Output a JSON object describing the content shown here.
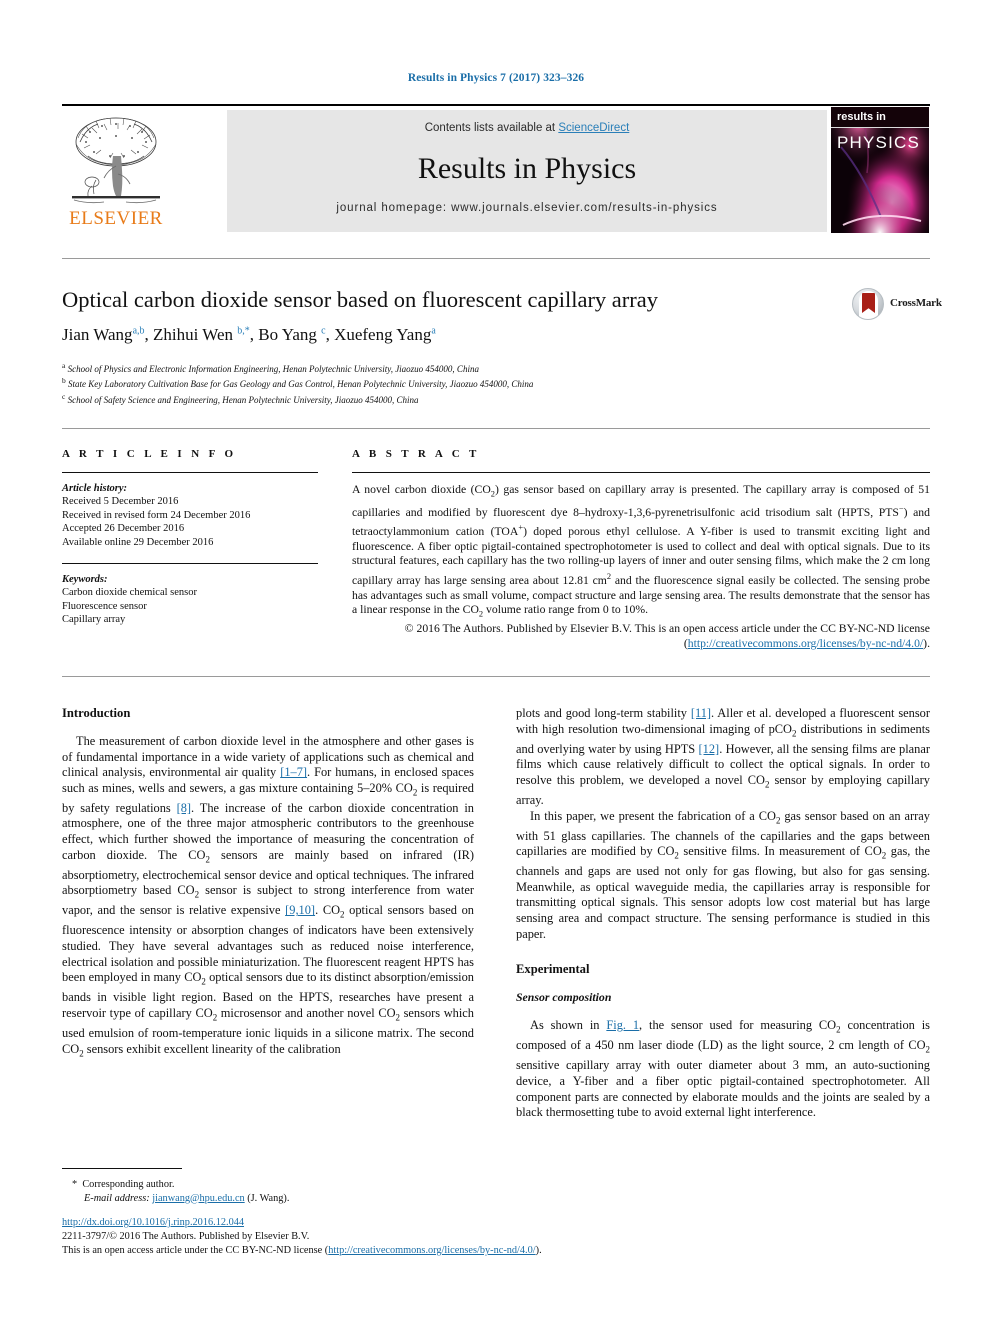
{
  "running_head": "Results in Physics 7 (2017) 323–326",
  "masthead": {
    "contents_prefix": "Contents lists available at ",
    "sciencedirect": "ScienceDirect",
    "journal_title": "Results in Physics",
    "homepage": "journal homepage: www.journals.elsevier.com/results-in-physics",
    "publisher_logo_text": "ELSEVIER",
    "cover_label_top": "results in",
    "cover_label_main": "PHYSICS",
    "accent_color": "#2a7fb8",
    "elsevier_orange": "#E87B19"
  },
  "article": {
    "title": "Optical carbon dioxide sensor based on fluorescent capillary array",
    "crossmark_label": "CrossMark",
    "authors_plain": "Jian Wang a,b, Zhihui Wen b,*, Bo Yang c, Xuefeng Yang a",
    "affiliations": [
      "School of Physics and Electronic Information Engineering, Henan Polytechnic University, Jiaozuo 454000, China",
      "State Key Laboratory Cultivation Base for Gas Geology and Gas Control, Henan Polytechnic University, Jiaozuo 454000, China",
      "School of Safety Science and Engineering, Henan Polytechnic University, Jiaozuo 454000, China"
    ]
  },
  "article_info": {
    "heading": "A R T I C L E   I N F O",
    "history_label": "Article history:",
    "history": [
      "Received 5 December 2016",
      "Received in revised form 24 December 2016",
      "Accepted 26 December 2016",
      "Available online 29 December 2016"
    ],
    "keywords_label": "Keywords:",
    "keywords": [
      "Carbon dioxide chemical sensor",
      "Fluorescence sensor",
      "Capillary array"
    ]
  },
  "abstract": {
    "heading": "A B S T R A C T",
    "body_part1": "A novel carbon dioxide (CO",
    "body_part2": ") gas sensor based on capillary array is presented. The capillary array is composed of 51 capillaries and modified by fluorescent dye 8–hydroxy-1,3,6-pyrenetrisulfonic acid trisodium salt (HPTS, PTS",
    "body_part3": ") and tetraoctylammonium cation (TOA",
    "body_part4": ") doped porous ethyl cellulose. A Y-fiber is used to transmit exciting light and fluorescence. A fiber optic pigtail-contained spectrophotometer is used to collect and deal with optical signals. Due to its structural features, each capillary has the two rolling-up layers of inner and outer sensing films, which make the 2 cm long capillary array has large sensing area about 12.81 cm",
    "body_part5": " and the fluorescence signal easily be collected. The sensing probe has advantages such as small volume, compact structure and large sensing area. The results demonstrate that the sensor has a linear response in the CO",
    "body_part6": " volume ratio range from 0 to 10%.",
    "copyright_text": "© 2016 The Authors. Published by Elsevier B.V. This is an open access article under the CC BY-NC-ND license (",
    "license_url": "http://creativecommons.org/licenses/by-nc-nd/4.0/",
    "copyright_tail": ")."
  },
  "body": {
    "left": {
      "introduction_heading": "Introduction",
      "p1_a": "The measurement of carbon dioxide level in the atmosphere and other gases is of fundamental importance in a wide variety of applications such as chemical and clinical analysis, environmental air quality ",
      "ref_1_7": "[1–7]",
      "p1_b": ". For humans, in enclosed spaces such as mines, wells and sewers, a gas mixture containing 5–20% CO",
      "p1_c": " is required by safety regulations ",
      "ref_8": "[8]",
      "p1_d": ". The increase of the carbon dioxide concentration in atmosphere, one of the three major atmospheric contributors to the greenhouse effect, which further showed the importance of measuring the concentration of carbon dioxide. The CO",
      "p1_e": " sensors are mainly based on infrared (IR) absorptiometry, electrochemical sensor device and optical techniques. The infrared absorptiometry based CO",
      "p1_f": " sensor is subject to strong interference from water vapor, and the sensor is relative expensive ",
      "ref_9_10": "[9,10]",
      "p1_g": ". CO",
      "p1_h": " optical sensors based on fluorescence intensity or absorption changes of indicators have been extensively studied. They have several advantages such as reduced noise interference, electrical isolation and possible miniaturization. The fluorescent reagent HPTS has been employed in many CO",
      "p1_i": " optical sensors due to its distinct absorption/emission bands in visible light region. Based on the HPTS, researches have present a reservoir type of capillary CO",
      "p1_j": " microsensor and another novel CO",
      "p1_k": " sensors which used emulsion of room-temperature ionic liquids in a silicone matrix. The second CO",
      "p1_l": " sensors exhibit excellent linearity of the calibration"
    },
    "right": {
      "p2_a": "plots and good long-term stability ",
      "ref_11": "[11]",
      "p2_b": ". Aller et al. developed a fluorescent sensor with high resolution two-dimensional imaging of pCO",
      "p2_c": " distributions in sediments and overlying water by using HPTS ",
      "ref_12": "[12]",
      "p2_d": ". However, all the sensing films are planar films which cause relatively difficult to collect the optical signals. In order to resolve this problem, we developed a novel CO",
      "p2_e": " sensor by employing capillary array.",
      "p3_a": "In this paper, we present the fabrication of a CO",
      "p3_b": " gas sensor based on an array with 51 glass capillaries. The channels of the capillaries and the gaps between capillaries are modified by CO",
      "p3_c": " sensitive films. In measurement of CO",
      "p3_d": " gas, the channels and gaps are used not only for gas flowing, but also for gas sensing. Meanwhile, as optical waveguide media, the capillaries array is responsible for transmitting optical signals. This sensor adopts low cost material but has large sensing area and compact structure. The sensing performance is studied in this paper.",
      "experimental_heading": "Experimental",
      "sensor_composition_heading": "Sensor composition",
      "p4_a": "As shown in ",
      "fig_ref": "Fig. 1",
      "p4_b": ", the sensor used for measuring CO",
      "p4_c": " concentration is composed of a 450 nm laser diode (LD) as the light source, 2 cm length of CO",
      "p4_d": " sensitive capillary array with outer diameter about 3 mm, an auto-suctioning device, a Y-fiber and a fiber optic pigtail-contained spectrophotometer. All component parts are connected by elaborate moulds and the joints are sealed by a black thermosetting tube to avoid external light interference."
    }
  },
  "footnote": {
    "star": "*",
    "corresponding": "Corresponding author.",
    "email_label": "E-mail address:",
    "email": "jianwang@hpu.edu.cn",
    "email_owner": "(J. Wang)."
  },
  "footer": {
    "doi": "http://dx.doi.org/10.1016/j.rinp.2016.12.044",
    "issn_line": "2211-3797/© 2016 The Authors. Published by Elsevier B.V.",
    "license_prefix": "This is an open access article under the CC BY-NC-ND license (",
    "license_url": "http://creativecommons.org/licenses/by-nc-nd/4.0/",
    "license_suffix": ")."
  }
}
